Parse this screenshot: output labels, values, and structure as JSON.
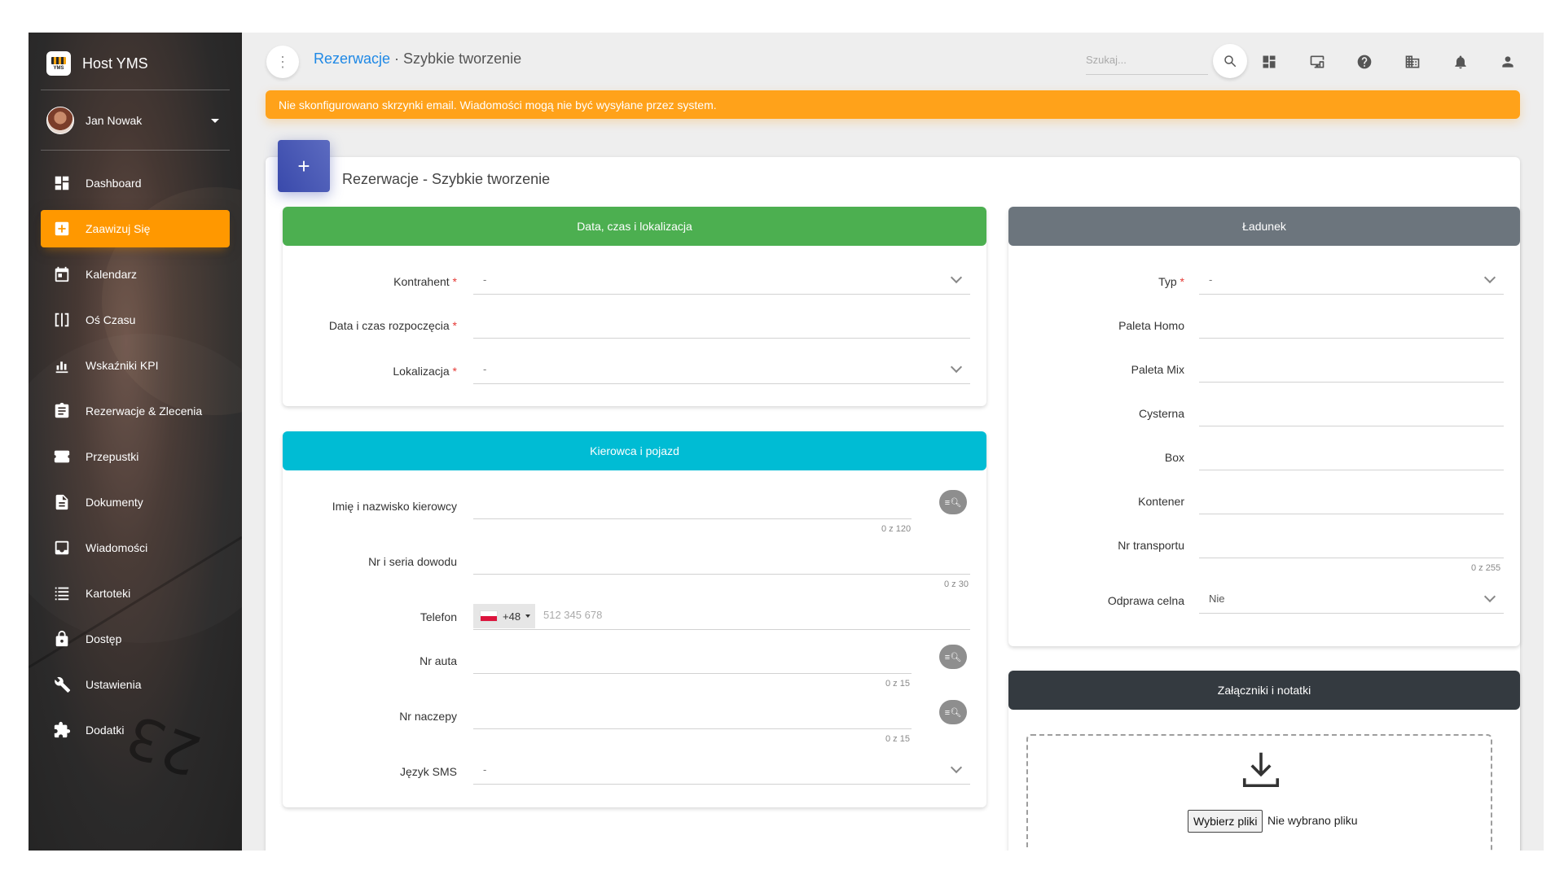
{
  "app": {
    "title": "Host YMS",
    "logo_text": "YMS"
  },
  "user": {
    "name": "Jan Nowak"
  },
  "sidebar": {
    "items": [
      {
        "label": "Dashboard",
        "icon": "dashboard-icon",
        "active": false
      },
      {
        "label": "Zaawizuj Się",
        "icon": "add-box-icon",
        "active": true
      },
      {
        "label": "Kalendarz",
        "icon": "calendar-icon",
        "active": false
      },
      {
        "label": "Oś Czasu",
        "icon": "timeline-icon",
        "active": false
      },
      {
        "label": "Wskaźniki KPI",
        "icon": "chart-icon",
        "active": false
      },
      {
        "label": "Rezerwacje & Zlecenia",
        "icon": "clipboard-icon",
        "active": false
      },
      {
        "label": "Przepustki",
        "icon": "ticket-icon",
        "active": false
      },
      {
        "label": "Dokumenty",
        "icon": "document-icon",
        "active": false
      },
      {
        "label": "Wiadomości",
        "icon": "inbox-icon",
        "active": false
      },
      {
        "label": "Kartoteki",
        "icon": "list-icon",
        "active": false
      },
      {
        "label": "Dostęp",
        "icon": "lock-icon",
        "active": false
      },
      {
        "label": "Ustawienia",
        "icon": "wrench-icon",
        "active": false
      },
      {
        "label": "Dodatki",
        "icon": "puzzle-icon",
        "active": false
      }
    ]
  },
  "header": {
    "breadcrumb_link": "Rezerwacje",
    "breadcrumb_sep": " · ",
    "breadcrumb_current": "Szybkie tworzenie",
    "search_placeholder": "Szukaj...",
    "icons": [
      "dashboard-icon",
      "monitor-icon",
      "help-icon",
      "building-icon",
      "bell-icon",
      "person-icon"
    ]
  },
  "alert": {
    "text": "Nie skonfigurowano skrzynki email. Wiadomości mogą nie być wysyłane przez system.",
    "color": "#ffa21a"
  },
  "page": {
    "title": "Rezerwacje - Szybkie tworzenie",
    "icon": "+"
  },
  "section_date": {
    "title": "Data, czas i lokalizacja",
    "color": "#4caf50",
    "contractor": {
      "label": "Kontrahent",
      "value": "-"
    },
    "start": {
      "label": "Data i czas rozpoczęcia",
      "value": ""
    },
    "location": {
      "label": "Lokalizacja",
      "value": "-"
    }
  },
  "section_driver": {
    "title": "Kierowca i pojazd",
    "color": "#00bcd4",
    "driver_name": {
      "label": "Imię i nazwisko kierowcy",
      "counter": "0 z 120"
    },
    "id_doc": {
      "label": "Nr i seria dowodu",
      "counter": "0 z 30"
    },
    "phone": {
      "label": "Telefon",
      "prefix": "+48",
      "placeholder": "512 345 678"
    },
    "car": {
      "label": "Nr auta",
      "counter": "0 z 15"
    },
    "trailer": {
      "label": "Nr naczepy",
      "counter": "0 z 15"
    },
    "sms_lang": {
      "label": "Język SMS",
      "value": "-"
    }
  },
  "section_cargo": {
    "title": "Ładunek",
    "color": "#6c757d",
    "type": {
      "label": "Typ",
      "value": "-"
    },
    "paleta_homo": "Paleta Homo",
    "paleta_mix": "Paleta Mix",
    "cysterna": "Cysterna",
    "box": "Box",
    "kontener": "Kontener",
    "transport": {
      "label": "Nr transportu",
      "counter": "0 z 255"
    },
    "customs": {
      "label": "Odprawa celna",
      "value": "Nie"
    }
  },
  "section_attach": {
    "title": "Załączniki i notatki",
    "color": "#343a40",
    "file_button": "Wybierz pliki",
    "file_status": "Nie wybrano pliku"
  }
}
